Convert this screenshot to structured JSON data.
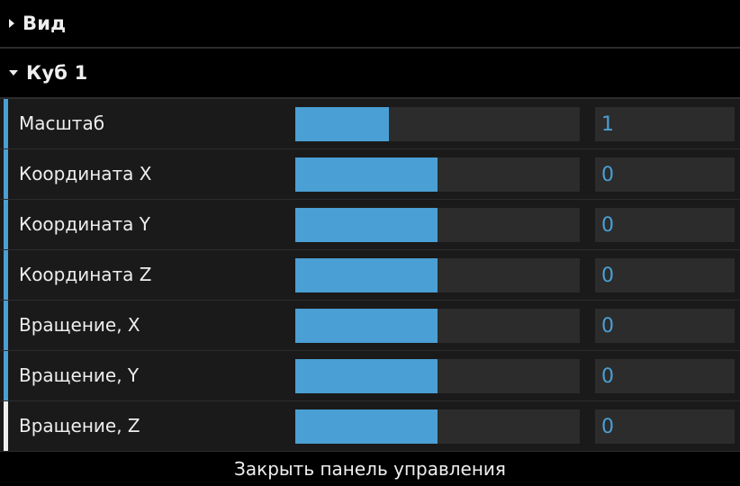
{
  "folders": [
    {
      "title": "Вид",
      "expanded": false
    },
    {
      "title": "Куб 1",
      "expanded": true
    }
  ],
  "controls": [
    {
      "label": "Масштаб",
      "value": "1",
      "fill_fraction": 0.33
    },
    {
      "label": "Координата X",
      "value": "0",
      "fill_fraction": 0.5
    },
    {
      "label": "Координата Y",
      "value": "0",
      "fill_fraction": 0.5
    },
    {
      "label": "Координата Z",
      "value": "0",
      "fill_fraction": 0.5
    },
    {
      "label": "Вращение, X",
      "value": "0",
      "fill_fraction": 0.5
    },
    {
      "label": "Вращение, Y",
      "value": "0",
      "fill_fraction": 0.5
    },
    {
      "label": "Вращение, Z",
      "value": "0",
      "fill_fraction": 0.5
    }
  ],
  "close_button": {
    "label": "Закрыть панель управления"
  },
  "colors": {
    "accent": "#4a9fd4",
    "accent_active": "#eeeeee",
    "background": "#000000",
    "row_background": "#1a1a1a",
    "field_background": "#2c2c2c",
    "text": "#eeeeee"
  }
}
